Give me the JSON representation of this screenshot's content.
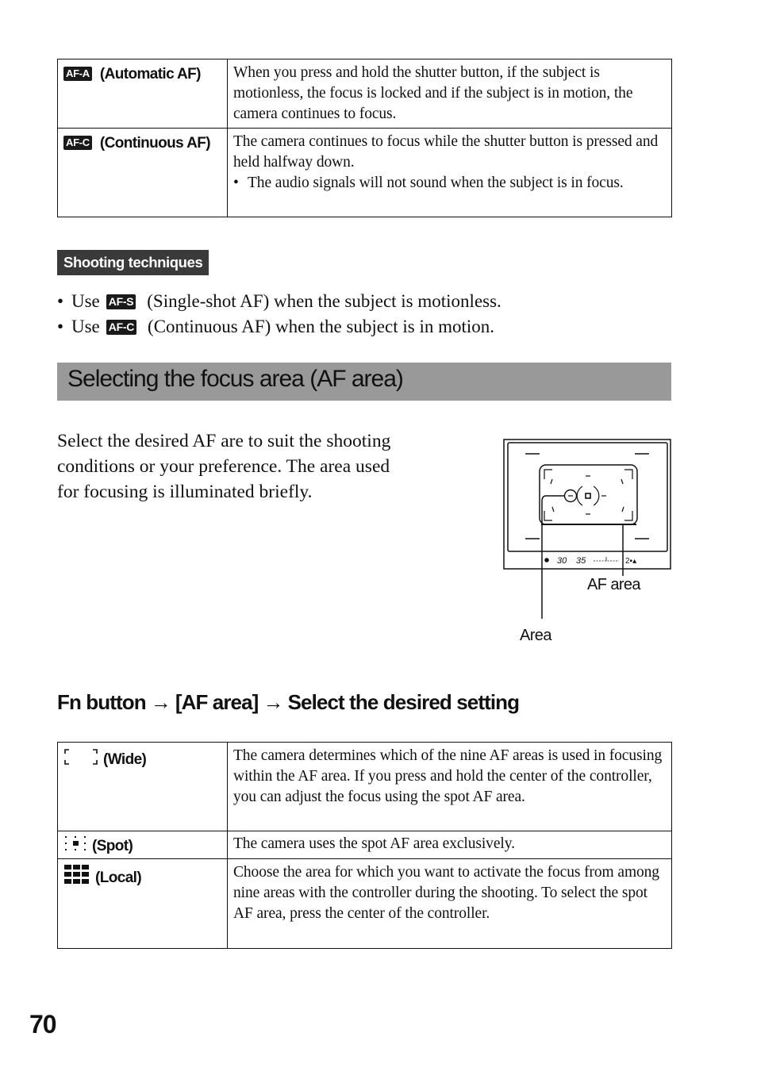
{
  "focus_mode_table": {
    "rows": [
      {
        "badge": "AF-A",
        "icon": "af-a-icon",
        "label": "(Automatic AF)",
        "description": "When you press and hold the shutter button, if the subject is motionless, the focus is locked and if the subject is in motion, the camera continues to focus.",
        "bullets": []
      },
      {
        "badge": "AF-C",
        "icon": "af-c-icon",
        "label": "(Continuous AF)",
        "description": "The camera continues to focus while the shutter button is pressed and held halfway down.",
        "bullets": [
          "The audio signals will not sound when the subject is in focus."
        ]
      }
    ]
  },
  "shooting_techniques": {
    "tag": "Shooting techniques",
    "items": [
      {
        "prefix": "Use",
        "badge": "AF-S",
        "text": "(Single-shot AF) when the subject is motionless."
      },
      {
        "prefix": "Use",
        "badge": "AF-C",
        "text": "(Continuous AF) when the subject is in motion."
      }
    ]
  },
  "section": {
    "title": "Selecting the focus area (AF area)",
    "intro": "Select the desired AF are to suit the shooting conditions or your preference. The area used for focusing is illuminated briefly."
  },
  "viewfinder": {
    "readout": [
      "30",
      "35"
    ],
    "callouts": {
      "af_area": "AF area",
      "area": "Area"
    }
  },
  "step": {
    "parts": [
      "Fn button",
      "[AF area]",
      "Select the desired setting"
    ],
    "arrow": "→"
  },
  "af_area_table": {
    "rows": [
      {
        "icon": "wide-af-icon",
        "label": "(Wide)",
        "description": "The camera determines which of the nine AF areas is used in focusing within the AF area. If you press and hold the center of the controller, you can adjust the focus using the spot AF area."
      },
      {
        "icon": "spot-af-icon",
        "label": "(Spot)",
        "description": "The camera uses the spot AF area exclusively."
      },
      {
        "icon": "local-af-icon",
        "label": "(Local)",
        "description": "Choose the area for which you want to activate the focus from among nine areas with the controller during the shooting. To select the spot AF area, press the center of the controller."
      }
    ]
  },
  "page_number": "70"
}
